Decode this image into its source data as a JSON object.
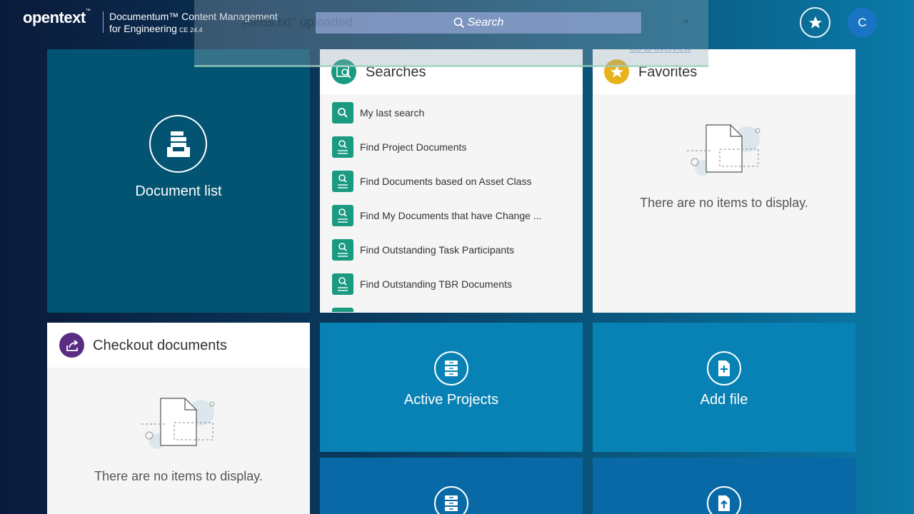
{
  "header": {
    "logo": "opentext",
    "logo_tm": "™",
    "product_line1": "Documentum™ Content Management",
    "product_line2": "for Engineering",
    "version": "CE 24.4",
    "search_placeholder": "Search",
    "favorites_icon": "star-icon",
    "user_initial": "C"
  },
  "toast": {
    "message": "\"Alerts.txt\" uploaded.",
    "close": "×",
    "link": "Go to overview"
  },
  "tiles": {
    "document_list": {
      "label": "Document list"
    },
    "searches": {
      "title": "Searches",
      "items": [
        "My last search",
        "Find Project Documents",
        "Find Documents based on Asset Class",
        "Find My Documents that have Change ...",
        "Find Outstanding Task Participants",
        "Find Outstanding TBR Documents"
      ]
    },
    "favorites": {
      "title": "Favorites",
      "empty": "There are no items to display."
    },
    "checkout": {
      "title": "Checkout documents",
      "empty": "There are no items to display."
    },
    "active_projects": {
      "label": "Active Projects"
    },
    "add_file": {
      "label": "Add file"
    }
  },
  "colors": {
    "searches_accent": "#1a9a80",
    "favorites_accent": "#e8b21a",
    "checkout_accent": "#5a2d82",
    "avatar": "#1a74c4"
  }
}
